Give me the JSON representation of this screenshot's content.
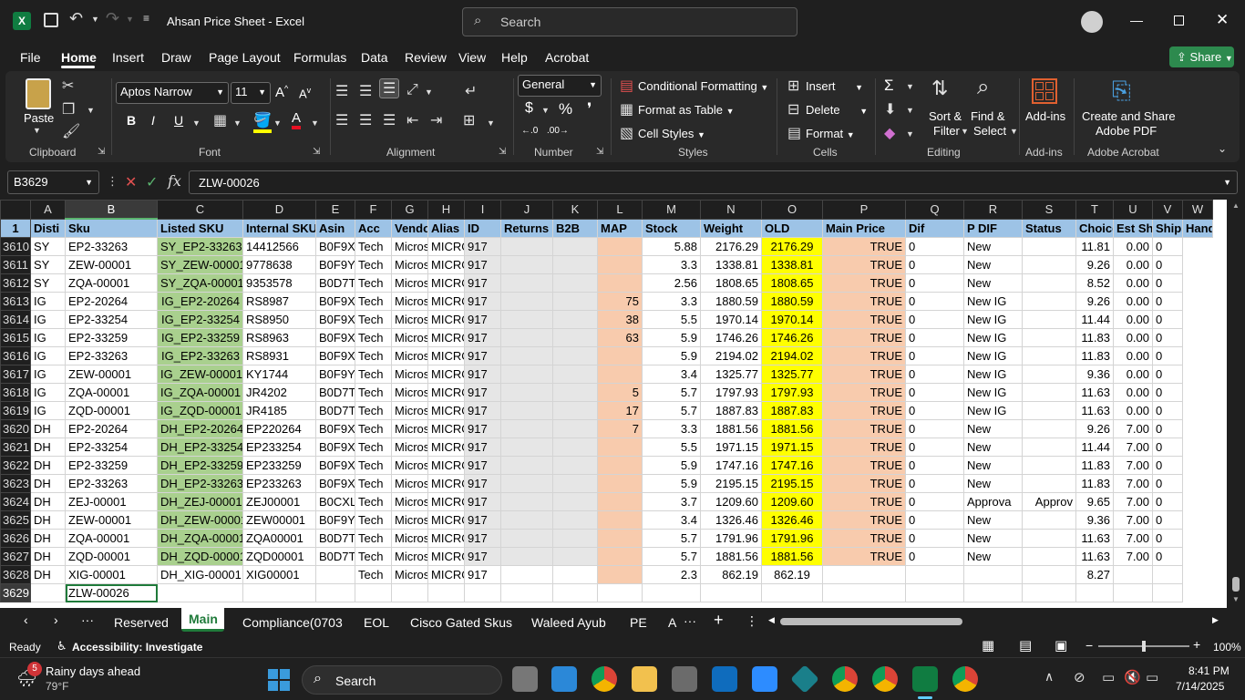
{
  "title": "Ahsan Price Sheet  -  Excel",
  "search_placeholder": "Search",
  "menu": [
    "File",
    "Home",
    "Insert",
    "Draw",
    "Page Layout",
    "Formulas",
    "Data",
    "Review",
    "View",
    "Help",
    "Acrobat"
  ],
  "share": "Share",
  "ribbon": {
    "paste": "Paste",
    "clipboard": "Clipboard",
    "font_name": "Aptos Narrow",
    "font_size": "11",
    "font": "Font",
    "alignment": "Alignment",
    "number_format": "General",
    "number": "Number",
    "cond_fmt": "Conditional Formatting",
    "format_table": "Format as Table",
    "cell_styles": "Cell Styles",
    "styles": "Styles",
    "insert": "Insert",
    "delete": "Delete",
    "format": "Format",
    "cells": "Cells",
    "sort1": "Sort &",
    "sort2": "Filter",
    "find1": "Find &",
    "find2": "Select",
    "editing": "Editing",
    "addins": "Add-ins",
    "addins_grp": "Add-ins",
    "adobe1": "Create and Share",
    "adobe2": "Adobe PDF",
    "adobe_grp": "Adobe Acrobat"
  },
  "name_box": "B3629",
  "formula": "ZLW-00026",
  "columns": [
    "A",
    "B",
    "C",
    "D",
    "E",
    "F",
    "G",
    "H",
    "I",
    "J",
    "K",
    "L",
    "M",
    "N",
    "O",
    "P",
    "Q",
    "R",
    "S",
    "T",
    "U",
    "V",
    "W"
  ],
  "header_row": {
    "num": "1",
    "cells": [
      "Disti",
      "Sku",
      "Listed SKU",
      "Internal SKU",
      "Asin",
      "Acc",
      "Vendo",
      "Alias",
      "ID",
      "Returns",
      "B2B",
      "MAP",
      "Stock",
      "Weight",
      "OLD",
      "Main Price",
      "Dif",
      "P DIF",
      "Status",
      "Choice",
      "Est Ship",
      "Ship",
      "Hand"
    ]
  },
  "rows": [
    [
      "3610",
      "SY",
      "EP2-33263",
      "SY_EP2-33263",
      "14412566",
      "B0F9XD",
      "Tech",
      "Micros",
      "MICRO",
      "917",
      "",
      "",
      "",
      "5.88",
      "2176.29",
      "2176.29",
      "TRUE",
      "0",
      "New",
      "",
      "11.81",
      "0.00",
      "0"
    ],
    [
      "3611",
      "SY",
      "ZEW-00001",
      "SY_ZEW-00001",
      "9778638",
      "B0F9Y1",
      "Tech",
      "Micros",
      "MICRO",
      "917",
      "",
      "",
      "",
      "3.3",
      "1338.81",
      "1338.81",
      "TRUE",
      "0",
      "New",
      "",
      "9.26",
      "0.00",
      "0"
    ],
    [
      "3612",
      "SY",
      "ZQA-00001",
      "SY_ZQA-00001",
      "9353578",
      "B0D7TI",
      "Tech",
      "Micros",
      "MICRO",
      "917",
      "",
      "",
      "",
      "2.56",
      "1808.65",
      "1808.65",
      "TRUE",
      "0",
      "New",
      "",
      "8.52",
      "0.00",
      "0"
    ],
    [
      "3613",
      "IG",
      "EP2-20264",
      "IG_EP2-20264",
      "RS8987",
      "B0F9XF",
      "Tech",
      "Micros",
      "MICRO",
      "917",
      "",
      "",
      "75",
      "3.3",
      "1880.59",
      "1880.59",
      "TRUE",
      "0",
      "New IG",
      "",
      "9.26",
      "0.00",
      "0"
    ],
    [
      "3614",
      "IG",
      "EP2-33254",
      "IG_EP2-33254",
      "RS8950",
      "B0F9X0",
      "Tech",
      "Micros",
      "MICRO",
      "917",
      "",
      "",
      "38",
      "5.5",
      "1970.14",
      "1970.14",
      "TRUE",
      "0",
      "New IG",
      "",
      "11.44",
      "0.00",
      "0"
    ],
    [
      "3615",
      "IG",
      "EP2-33259",
      "IG_EP2-33259",
      "RS8963",
      "B0F9XE",
      "Tech",
      "Micros",
      "MICRO",
      "917",
      "",
      "",
      "63",
      "5.9",
      "1746.26",
      "1746.26",
      "TRUE",
      "0",
      "New IG",
      "",
      "11.83",
      "0.00",
      "0"
    ],
    [
      "3616",
      "IG",
      "EP2-33263",
      "IG_EP2-33263",
      "RS8931",
      "B0F9XD",
      "Tech",
      "Micros",
      "MICRO",
      "917",
      "",
      "",
      "",
      "5.9",
      "2194.02",
      "2194.02",
      "TRUE",
      "0",
      "New IG",
      "",
      "11.83",
      "0.00",
      "0"
    ],
    [
      "3617",
      "IG",
      "ZEW-00001",
      "IG_ZEW-00001",
      "KY1744",
      "B0F9Y1",
      "Tech",
      "Micros",
      "MICRO",
      "917",
      "",
      "",
      "",
      "3.4",
      "1325.77",
      "1325.77",
      "TRUE",
      "0",
      "New IG",
      "",
      "9.36",
      "0.00",
      "0"
    ],
    [
      "3618",
      "IG",
      "ZQA-00001",
      "IG_ZQA-00001",
      "JR4202",
      "B0D7TI",
      "Tech",
      "Micros",
      "MICRO",
      "917",
      "",
      "",
      "5",
      "5.7",
      "1797.93",
      "1797.93",
      "TRUE",
      "0",
      "New IG",
      "",
      "11.63",
      "0.00",
      "0"
    ],
    [
      "3619",
      "IG",
      "ZQD-00001",
      "IG_ZQD-00001",
      "JR4185",
      "B0D7T0",
      "Tech",
      "Micros",
      "MICRO",
      "917",
      "",
      "",
      "17",
      "5.7",
      "1887.83",
      "1887.83",
      "TRUE",
      "0",
      "New IG",
      "",
      "11.63",
      "0.00",
      "0"
    ],
    [
      "3620",
      "DH",
      "EP2-20264",
      "DH_EP2-20264",
      "EP220264",
      "B0F9XF",
      "Tech",
      "Micros",
      "MICRO",
      "917",
      "",
      "",
      "7",
      "3.3",
      "1881.56",
      "1881.56",
      "TRUE",
      "0",
      "New",
      "",
      "9.26",
      "7.00",
      "0"
    ],
    [
      "3621",
      "DH",
      "EP2-33254",
      "DH_EP2-33254",
      "EP233254",
      "B0F9X0",
      "Tech",
      "Micros",
      "MICRO",
      "917",
      "",
      "",
      "",
      "5.5",
      "1971.15",
      "1971.15",
      "TRUE",
      "0",
      "New",
      "",
      "11.44",
      "7.00",
      "0"
    ],
    [
      "3622",
      "DH",
      "EP2-33259",
      "DH_EP2-33259",
      "EP233259",
      "B0F9XE",
      "Tech",
      "Micros",
      "MICRO",
      "917",
      "",
      "",
      "",
      "5.9",
      "1747.16",
      "1747.16",
      "TRUE",
      "0",
      "New",
      "",
      "11.83",
      "7.00",
      "0"
    ],
    [
      "3623",
      "DH",
      "EP2-33263",
      "DH_EP2-33263",
      "EP233263",
      "B0F9XD",
      "Tech",
      "Micros",
      "MICRO",
      "917",
      "",
      "",
      "",
      "5.9",
      "2195.15",
      "2195.15",
      "TRUE",
      "0",
      "New",
      "",
      "11.83",
      "7.00",
      "0"
    ],
    [
      "3624",
      "DH",
      "ZEJ-00001",
      "DH_ZEJ-00001",
      "ZEJ00001",
      "B0CXL1",
      "Tech",
      "Micros",
      "MICRO",
      "917",
      "",
      "",
      "",
      "3.7",
      "1209.60",
      "1209.60",
      "TRUE",
      "0",
      "Approva",
      "Approv",
      "9.65",
      "7.00",
      "0"
    ],
    [
      "3625",
      "DH",
      "ZEW-00001",
      "DH_ZEW-00001",
      "ZEW00001",
      "B0F9Y1",
      "Tech",
      "Micros",
      "MICRO",
      "917",
      "",
      "",
      "",
      "3.4",
      "1326.46",
      "1326.46",
      "TRUE",
      "0",
      "New",
      "",
      "9.36",
      "7.00",
      "0"
    ],
    [
      "3626",
      "DH",
      "ZQA-00001",
      "DH_ZQA-00001",
      "ZQA00001",
      "B0D7TI",
      "Tech",
      "Micros",
      "MICRO",
      "917",
      "",
      "",
      "",
      "5.7",
      "1791.96",
      "1791.96",
      "TRUE",
      "0",
      "New",
      "",
      "11.63",
      "7.00",
      "0"
    ],
    [
      "3627",
      "DH",
      "ZQD-00001",
      "DH_ZQD-00001",
      "ZQD00001",
      "B0D7T0",
      "Tech",
      "Micros",
      "MICRO",
      "917",
      "",
      "",
      "",
      "5.7",
      "1881.56",
      "1881.56",
      "TRUE",
      "0",
      "New",
      "",
      "11.63",
      "7.00",
      "0"
    ],
    [
      "3628",
      "DH",
      "XIG-00001",
      "DH_XIG-00001",
      "XIG00001",
      "",
      "Tech",
      "Micros",
      "MICRO",
      "917",
      "",
      "",
      "",
      "2.3",
      "862.19",
      "862.19",
      "",
      "",
      "",
      "",
      "8.27",
      "",
      ""
    ],
    [
      "3629",
      "",
      "ZLW-00026",
      "",
      "",
      "",
      "",
      "",
      "",
      "",
      "",
      "",
      "",
      "",
      "",
      "",
      "",
      "",
      "",
      "",
      "",
      "",
      ""
    ]
  ],
  "sheet_tabs": [
    "Reserved",
    "Main",
    "Compliance(0703",
    "EOL",
    "Cisco Gated Skus",
    "Waleed Ayub",
    "PE",
    "A"
  ],
  "active_tab": "Main",
  "status": {
    "ready": "Ready",
    "accessibility": "Accessibility: Investigate",
    "zoom": "100%"
  },
  "taskbar": {
    "weather_badge": "5",
    "weather1": "Rainy days ahead",
    "weather2": "79°F",
    "search": "Search",
    "time": "8:41 PM",
    "date": "7/14/2025"
  }
}
